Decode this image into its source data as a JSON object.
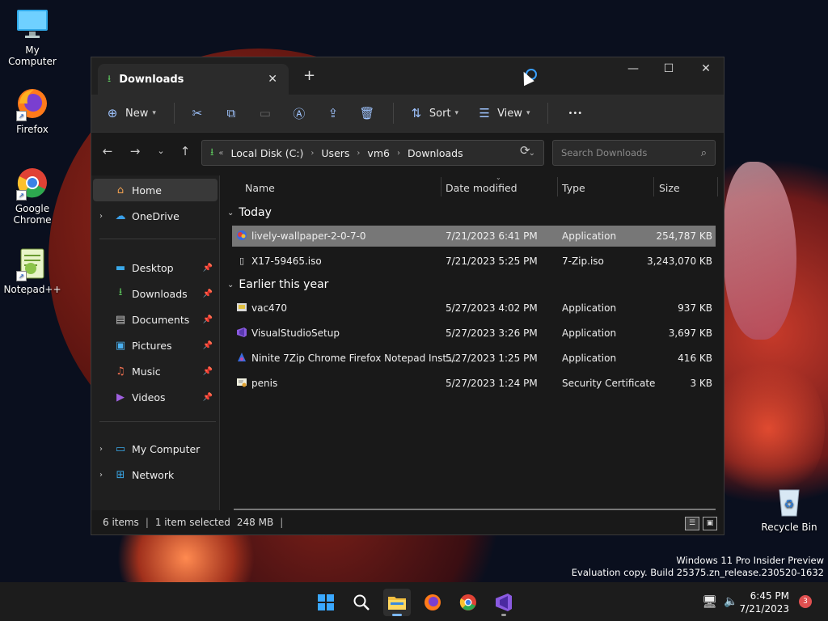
{
  "desktop": {
    "icons": [
      {
        "label": "My Computer",
        "icon": "monitor-icon"
      },
      {
        "label": "Firefox",
        "icon": "firefox-icon"
      },
      {
        "label": "Google Chrome",
        "icon": "chrome-icon"
      },
      {
        "label": "Notepad++",
        "icon": "notepadpp-icon"
      }
    ],
    "recycle_bin": "Recycle Bin",
    "watermark": {
      "line1": "Windows 11 Pro Insider Preview",
      "line2": "Evaluation copy. Build 25375.zn_release.230520-1632"
    }
  },
  "window": {
    "tab_title": "Downloads",
    "new_tab": "+",
    "controls": {
      "minimize": "—",
      "maximize": "☐",
      "close": "✕"
    },
    "toolbar": {
      "new": "New",
      "sort": "Sort",
      "view": "View",
      "more": "•••"
    },
    "address": {
      "prefix": "«",
      "crumbs": [
        "Local Disk (C:)",
        "Users",
        "vm6",
        "Downloads"
      ],
      "chevron": "›",
      "search_placeholder": "Search Downloads"
    },
    "sidebar": {
      "items": [
        {
          "label": "Home",
          "icon": "home-icon",
          "selected": true
        },
        {
          "label": "OneDrive",
          "icon": "onedrive-icon",
          "expandable": true
        },
        {
          "label": "Desktop",
          "icon": "desktop-icon",
          "pinned": true
        },
        {
          "label": "Downloads",
          "icon": "download-icon",
          "pinned": true
        },
        {
          "label": "Documents",
          "icon": "documents-icon",
          "pinned": true
        },
        {
          "label": "Pictures",
          "icon": "pictures-icon",
          "pinned": true
        },
        {
          "label": "Music",
          "icon": "music-icon",
          "pinned": true
        },
        {
          "label": "Videos",
          "icon": "videos-icon",
          "pinned": true
        },
        {
          "label": "My Computer",
          "icon": "monitor-icon",
          "expandable": true
        },
        {
          "label": "Network",
          "icon": "network-icon",
          "expandable": true
        }
      ]
    },
    "columns": {
      "name": "Name",
      "date": "Date modified",
      "type": "Type",
      "size": "Size"
    },
    "groups": [
      {
        "label": "Today",
        "files": [
          {
            "name": "lively-wallpaper-2-0-7-0",
            "date": "7/21/2023 6:41 PM",
            "type": "Application",
            "size": "254,787 KB",
            "selected": true,
            "icon": "lively-app-icon"
          },
          {
            "name": "X17-59465.iso",
            "date": "7/21/2023 5:25 PM",
            "type": "7-Zip.iso",
            "size": "3,243,070 KB",
            "icon": "file-icon"
          }
        ]
      },
      {
        "label": "Earlier this year",
        "files": [
          {
            "name": "vac470",
            "date": "5/27/2023 4:02 PM",
            "type": "Application",
            "size": "937 KB",
            "icon": "installer-icon"
          },
          {
            "name": "VisualStudioSetup",
            "date": "5/27/2023 3:26 PM",
            "type": "Application",
            "size": "3,697 KB",
            "icon": "visual-studio-icon"
          },
          {
            "name": "Ninite 7Zip Chrome Firefox Notepad Inst...",
            "date": "5/27/2023 1:25 PM",
            "type": "Application",
            "size": "416 KB",
            "icon": "ninite-icon"
          },
          {
            "name": "penis",
            "date": "5/27/2023 1:24 PM",
            "type": "Security Certificate",
            "size": "3 KB",
            "icon": "certificate-icon"
          }
        ]
      }
    ],
    "status": {
      "items": "6 items",
      "selected": "1 item selected",
      "size": "248 MB"
    }
  },
  "taskbar": {
    "clock_time": "6:45 PM",
    "clock_date": "7/21/2023",
    "notifications": "3"
  }
}
